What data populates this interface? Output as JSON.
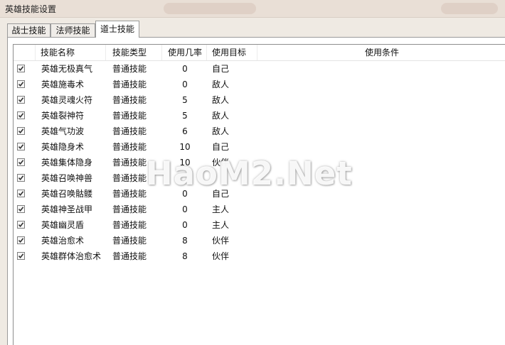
{
  "window": {
    "title": "英雄技能设置"
  },
  "tabs": [
    {
      "label": "战士技能",
      "active": false
    },
    {
      "label": "法师技能",
      "active": false
    },
    {
      "label": "道士技能",
      "active": true
    }
  ],
  "table": {
    "columns": [
      "技能名称",
      "技能类型",
      "使用几率",
      "使用目标",
      "使用条件"
    ],
    "rows": [
      {
        "checked": true,
        "name": "英雄无极真气",
        "type": "普通技能",
        "rate": "0",
        "target": "自己",
        "condition": ""
      },
      {
        "checked": true,
        "name": "英雄施毒术",
        "type": "普通技能",
        "rate": "0",
        "target": "敌人",
        "condition": ""
      },
      {
        "checked": true,
        "name": "英雄灵魂火符",
        "type": "普通技能",
        "rate": "5",
        "target": "敌人",
        "condition": ""
      },
      {
        "checked": true,
        "name": "英雄裂神符",
        "type": "普通技能",
        "rate": "5",
        "target": "敌人",
        "condition": ""
      },
      {
        "checked": true,
        "name": "英雄气功波",
        "type": "普通技能",
        "rate": "6",
        "target": "敌人",
        "condition": ""
      },
      {
        "checked": true,
        "name": "英雄隐身术",
        "type": "普通技能",
        "rate": "10",
        "target": "自己",
        "condition": ""
      },
      {
        "checked": true,
        "name": "英雄集体隐身",
        "type": "普通技能",
        "rate": "10",
        "target": "伙伴",
        "condition": ""
      },
      {
        "checked": true,
        "name": "英雄召唤神兽",
        "type": "普通技能",
        "rate": "",
        "target": "",
        "condition": ""
      },
      {
        "checked": true,
        "name": "英雄召唤骷髅",
        "type": "普通技能",
        "rate": "0",
        "target": "自己",
        "condition": ""
      },
      {
        "checked": true,
        "name": "英雄神圣战甲",
        "type": "普通技能",
        "rate": "0",
        "target": "主人",
        "condition": ""
      },
      {
        "checked": true,
        "name": "英雄幽灵盾",
        "type": "普通技能",
        "rate": "0",
        "target": "主人",
        "condition": ""
      },
      {
        "checked": true,
        "name": "英雄治愈术",
        "type": "普通技能",
        "rate": "8",
        "target": "伙伴",
        "condition": ""
      },
      {
        "checked": true,
        "name": "英雄群体治愈术",
        "type": "普通技能",
        "rate": "8",
        "target": "伙伴",
        "condition": ""
      }
    ]
  },
  "watermark": "HaoM2.Net"
}
